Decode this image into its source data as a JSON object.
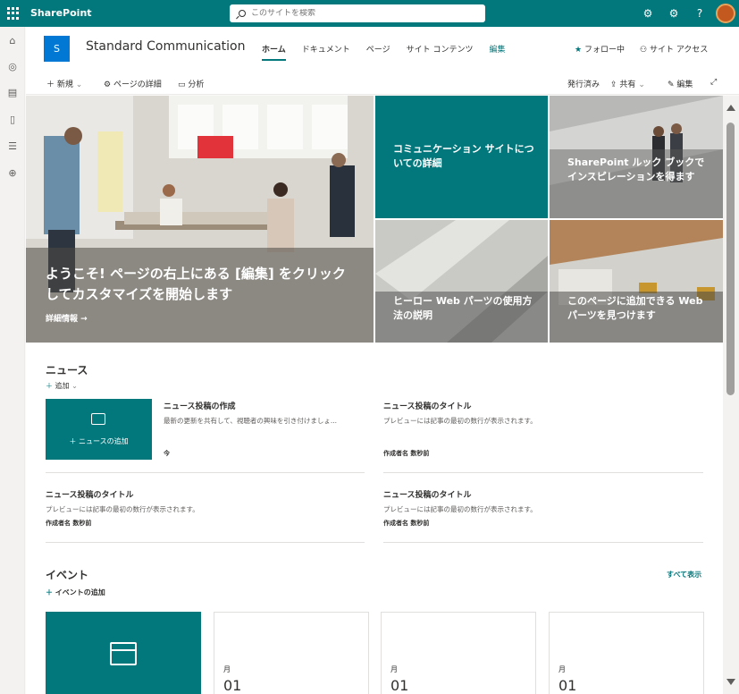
{
  "suitebar": {
    "brand": "SharePoint",
    "search_placeholder": "このサイトを検索"
  },
  "header": {
    "logo_letter": "S",
    "site_title": "Standard Communication",
    "nav": [
      "ホーム",
      "ドキュメント",
      "ページ",
      "サイト コンテンツ",
      "編集"
    ],
    "follow": "フォロー中",
    "site_access": "サイト アクセス"
  },
  "commandbar": {
    "new": "新規",
    "page_details": "ページの詳細",
    "analytics": "分析",
    "published": "発行済み",
    "share": "共有",
    "edit": "編集"
  },
  "hero": {
    "main_title": "ようこそ! ページの右上にある [編集] をクリックしてカスタマイズを開始します",
    "main_link": "詳細情報 →",
    "tile1": "コミュニケーション サイトについての詳細",
    "tile2": "SharePoint ルック ブックでインスピレーションを得ます",
    "tile3": "ヒーロー Web パーツの使用方法の説明",
    "tile4": "このページに追加できる Web パーツを見つけます"
  },
  "news": {
    "title": "ニュース",
    "add": "追加",
    "add_news_label": "ニュースの追加",
    "create_title": "ニュース投稿の作成",
    "create_desc": "最新の更新を共有して、視聴者の興味を引き付けましょ...",
    "create_time": "今",
    "post_title": "ニュース投稿のタイトル",
    "post_desc": "プレビューには記事の最初の数行が表示されます。",
    "post_meta": "作成者名  数秒前"
  },
  "events": {
    "title": "イベント",
    "add": "イベントの追加",
    "see_all": "すべて表示",
    "month": "月",
    "day": "01"
  },
  "colors": {
    "accent": "#03787c",
    "text": "#323130"
  }
}
